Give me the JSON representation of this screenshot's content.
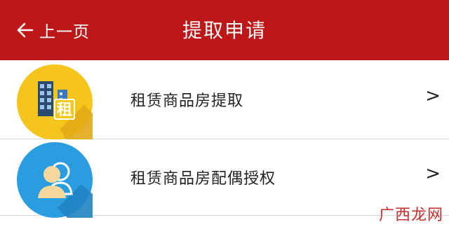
{
  "header": {
    "back_label": "上一页",
    "title": "提取申请",
    "background": "#be1717"
  },
  "items": [
    {
      "label": "租赁商品房提取",
      "chevron": ">",
      "icon": "building-rent-icon",
      "icon_color": "#f4c51c",
      "badge": "租"
    },
    {
      "label": "租赁商品房配偶授权",
      "chevron": ">",
      "icon": "user-pair-icon",
      "icon_color": "#2a9de0"
    }
  ],
  "watermark": "广西龙网"
}
